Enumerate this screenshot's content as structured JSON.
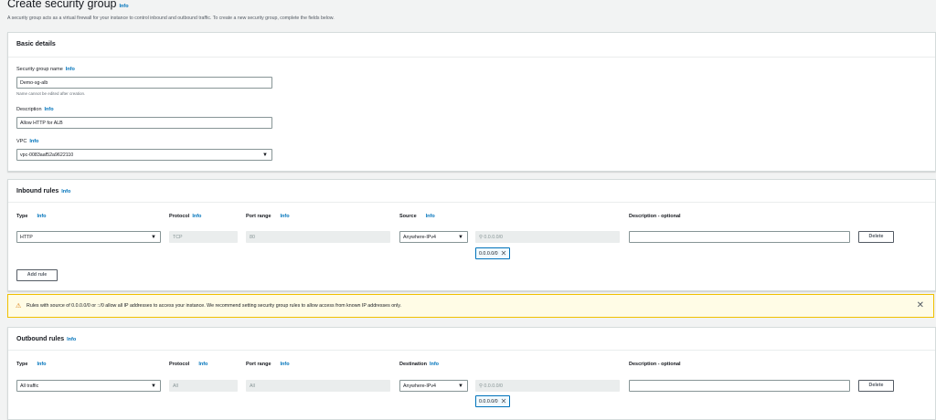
{
  "page": {
    "title": "Create security group",
    "info": "Info",
    "description": "A security group acts as a virtual firewall for your instance to control inbound and outbound traffic. To create a new security group, complete the fields below."
  },
  "basic": {
    "heading": "Basic details",
    "name_label": "Security group name",
    "name_value": "Demo-sg-alb",
    "name_hint": "Name cannot be edited after creation.",
    "desc_label": "Description",
    "desc_value": "Allow HTTP for ALB",
    "vpc_label": "VPC",
    "vpc_value": "vpc-0083aaf52a9622110"
  },
  "inbound": {
    "heading": "Inbound rules",
    "col_type": "Type",
    "col_protocol": "Protocol",
    "col_port": "Port range",
    "col_source": "Source",
    "col_desc": "Description - optional",
    "type_value": "HTTP",
    "protocol_value": "TCP",
    "port_value": "80",
    "source_value": "Anywhere-IPv4",
    "cidr_placeholder": "0.0.0.0/0",
    "chip": "0.0.0.0/0",
    "delete": "Delete",
    "add_rule": "Add rule"
  },
  "warning": {
    "text": "Rules with source of 0.0.0.0/0 or ::/0 allow all IP addresses to access your instance. We recommend setting security group rules to allow access from known IP addresses only."
  },
  "outbound": {
    "heading": "Outbound rules",
    "col_type": "Type",
    "col_protocol": "Protocol",
    "col_port": "Port range",
    "col_dest": "Destination",
    "col_desc": "Description - optional",
    "type_value": "All traffic",
    "protocol_value": "All",
    "port_value": "All",
    "dest_value": "Anywhere-IPv4",
    "cidr_placeholder": "0.0.0.0/0",
    "chip": "0.0.0.0/0",
    "delete": "Delete"
  },
  "icons": {
    "caret": "caret-down-icon",
    "search": "search-icon",
    "warning": "warning-icon",
    "close": "close-icon"
  }
}
